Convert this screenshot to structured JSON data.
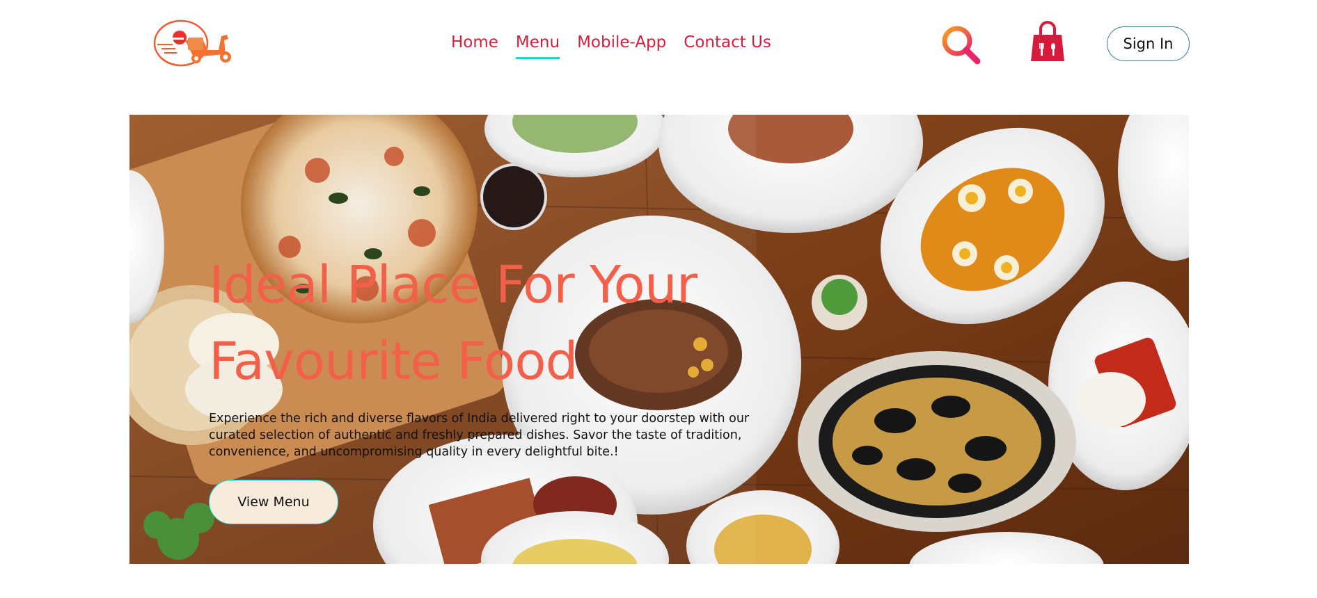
{
  "header": {
    "logo_icon": "scooter-delivery-logo",
    "nav": [
      {
        "label": "Home",
        "active": false
      },
      {
        "label": "Menu",
        "active": true
      },
      {
        "label": "Mobile-App",
        "active": false
      },
      {
        "label": "Contact Us",
        "active": false
      }
    ],
    "search_icon": "search-icon",
    "cart_icon": "shopping-bag-icon",
    "signin_label": "Sign In"
  },
  "hero": {
    "title_lines": [
      "Ideal Place For Your",
      "Favourite Food"
    ],
    "description_lines": [
      "Experience the rich and diverse flavors of India delivered right to your doorstep with our",
      "curated selection of authentic and freshly prepared dishes. Savor the taste of tradition,",
      "convenience, and uncompromising quality in every delightful bite.!"
    ],
    "cta_label": "View Menu",
    "background": "food-table-photo"
  },
  "colors": {
    "nav_text": "#d41f3f",
    "nav_active_underline": "#1ad9d2",
    "hero_title": "#f2604a",
    "cta_bg": "#f7ebdc",
    "cta_border": "#1ad9d2",
    "signin_border": "#2b7f86"
  }
}
